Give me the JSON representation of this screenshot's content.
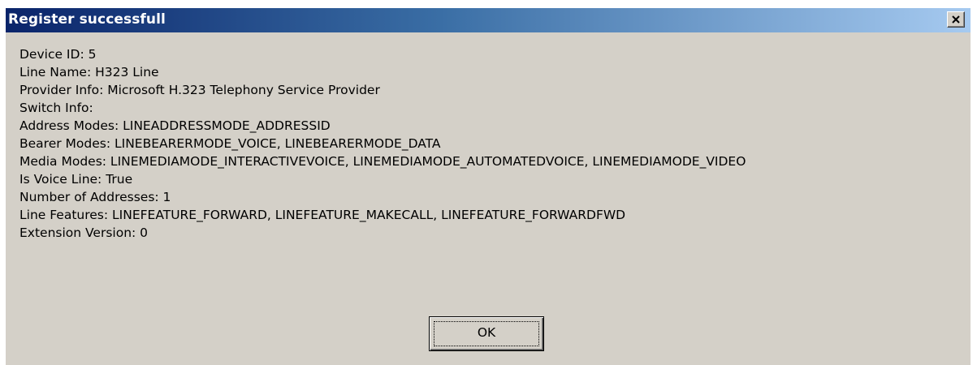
{
  "window": {
    "title": "Register successfull",
    "close_icon": "close-icon"
  },
  "info_lines": [
    "Device ID: 5",
    "Line Name: H323 Line",
    "Provider Info: Microsoft H.323 Telephony Service Provider",
    "Switch Info:",
    "Address Modes: LINEADDRESSMODE_ADDRESSID",
    "Bearer Modes: LINEBEARERMODE_VOICE, LINEBEARERMODE_DATA",
    "Media Modes: LINEMEDIAMODE_INTERACTIVEVOICE, LINEMEDIAMODE_AUTOMATEDVOICE, LINEMEDIAMODE_VIDEO",
    "Is Voice Line: True",
    "Number of Addresses: 1",
    "Line Features: LINEFEATURE_FORWARD, LINEFEATURE_MAKECALL, LINEFEATURE_FORWARDFWD",
    "Extension Version: 0"
  ],
  "buttons": {
    "ok_label": "OK"
  }
}
